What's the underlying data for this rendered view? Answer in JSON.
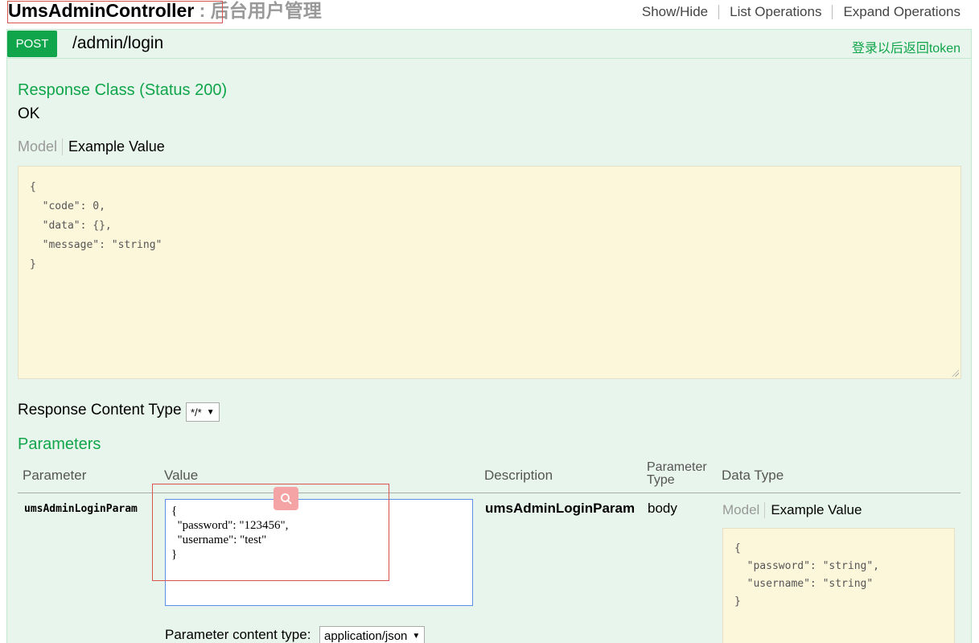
{
  "resource": {
    "controller": "UmsAdminController",
    "description": " : 后台用户管理",
    "links": [
      "Show/Hide",
      "List Operations",
      "Expand Operations"
    ]
  },
  "operation": {
    "method": "POST",
    "path": "/admin/login",
    "summary": "登录以后返回token"
  },
  "response": {
    "class_title": "Response Class (Status 200)",
    "status_text": "OK",
    "tab_model": "Model",
    "tab_example": "Example Value",
    "example_lines": [
      "{",
      "  \"code\": 0,",
      "  \"data\": {},",
      "  \"message\": \"string\"",
      "}"
    ],
    "content_type_label": "Response Content Type",
    "content_type_value": "*/*"
  },
  "parameters": {
    "title": "Parameters",
    "headers": {
      "parameter": "Parameter",
      "value": "Value",
      "description": "Description",
      "parameter_type": "Parameter Type",
      "data_type": "Data Type"
    },
    "row": {
      "name": "umsAdminLoginParam",
      "value_text": "{\n  \"password\": \"123456\",\n  \"username\": \"test\"\n}",
      "description": "umsAdminLoginParam",
      "param_type": "body",
      "tab_model": "Model",
      "tab_example": "Example Value",
      "example_lines": [
        "{",
        "  \"password\": \"string\",",
        "  \"username\": \"string\"",
        "}"
      ]
    },
    "content_type_label": "Parameter content type:",
    "content_type_value": "application/json"
  },
  "icons": {
    "search_overlay": "search-icon"
  },
  "colors": {
    "accent_green": "#10a54a",
    "panel_bg": "#e8f5ec",
    "json_bg": "#fcf6db",
    "highlight_red": "#d9534f"
  }
}
